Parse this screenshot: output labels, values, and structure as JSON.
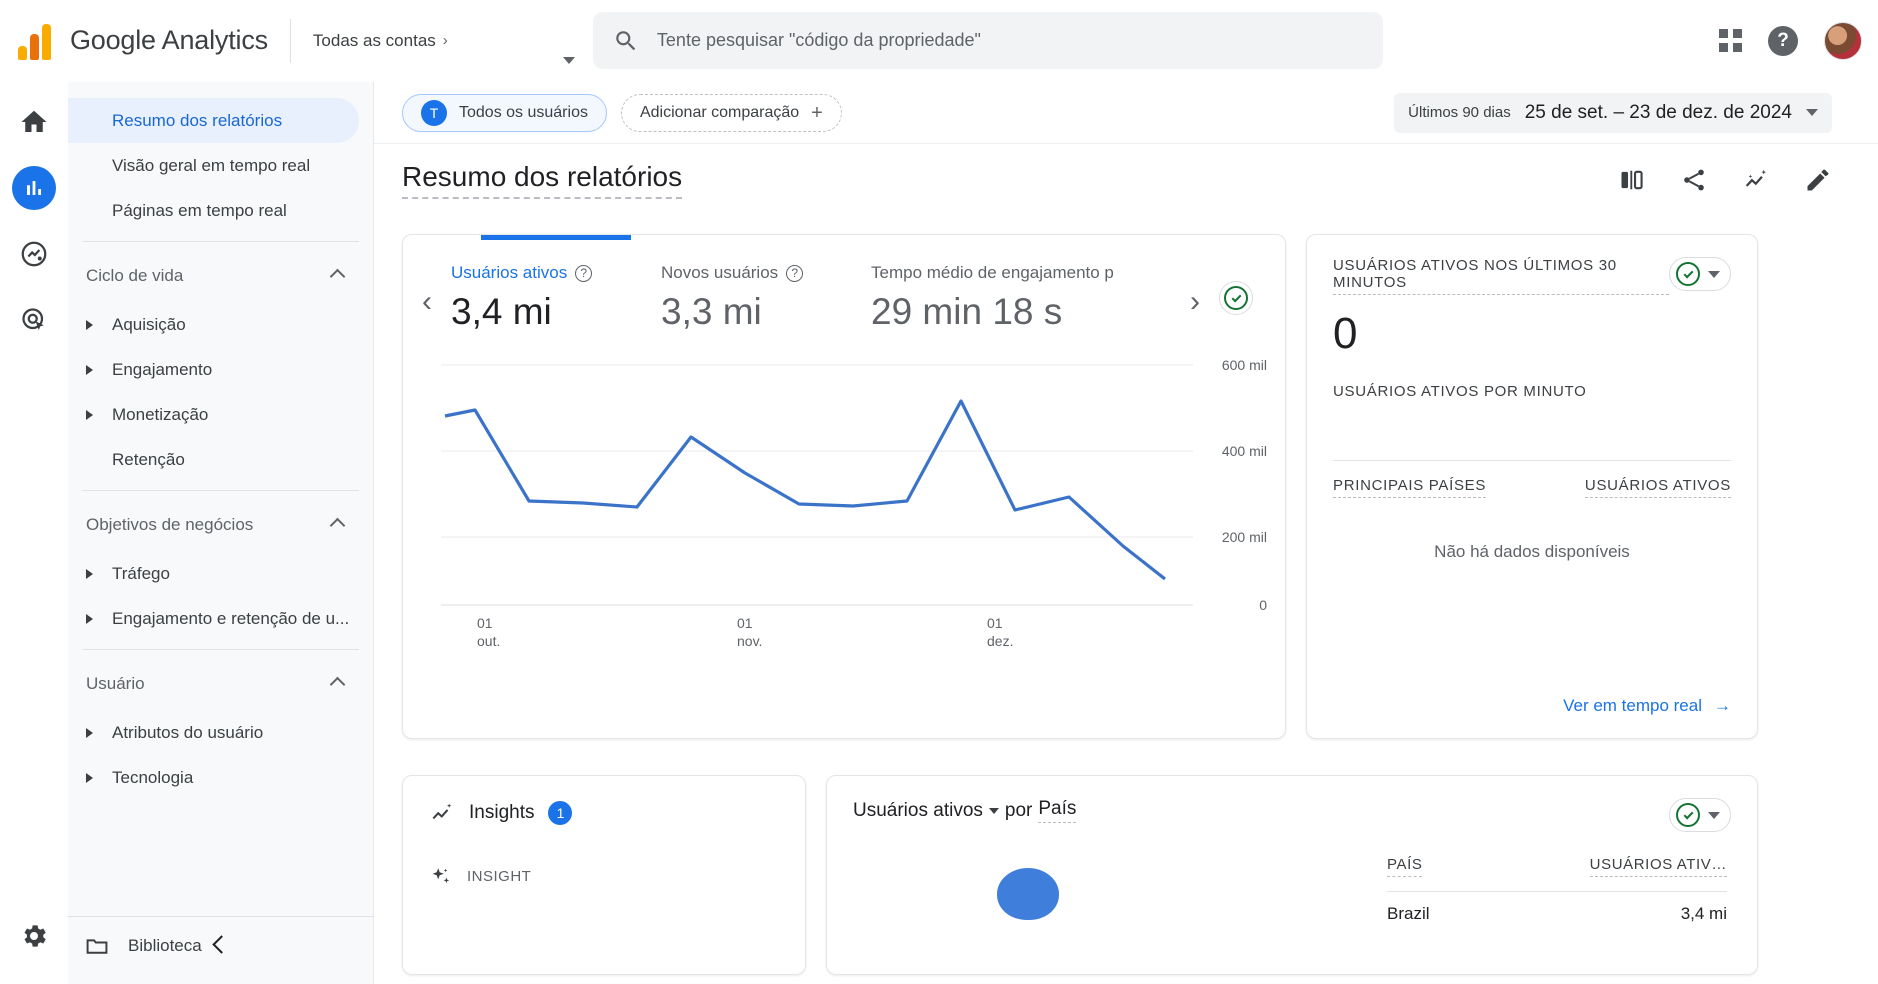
{
  "header": {
    "brand": "Google Analytics",
    "account_label": "Todas as contas",
    "account_chevron": "›",
    "search_placeholder": "Tente pesquisar \"código da propriedade\"",
    "apps_icon": "apps-grid-icon",
    "help_icon": "help-icon",
    "help_glyph": "?",
    "avatar_icon": "user-avatar"
  },
  "rail": {
    "items": [
      {
        "name": "home-icon",
        "label": "Início"
      },
      {
        "name": "reports-icon",
        "label": "Relatórios"
      },
      {
        "name": "explore-icon",
        "label": "Explorar"
      },
      {
        "name": "advertising-icon",
        "label": "Publicidade"
      }
    ],
    "settings": {
      "name": "gear-icon",
      "label": "Administrador"
    }
  },
  "sidebar": {
    "top_items": [
      {
        "label": "Resumo dos relatórios",
        "selected": true
      },
      {
        "label": "Visão geral em tempo real",
        "selected": false
      },
      {
        "label": "Páginas em tempo real",
        "selected": false
      }
    ],
    "groups": [
      {
        "title": "Ciclo de vida",
        "items": [
          {
            "label": "Aquisição",
            "expandable": true
          },
          {
            "label": "Engajamento",
            "expandable": true
          },
          {
            "label": "Monetização",
            "expandable": true
          },
          {
            "label": "Retenção",
            "expandable": false
          }
        ]
      },
      {
        "title": "Objetivos de negócios",
        "items": [
          {
            "label": "Tráfego",
            "expandable": true
          },
          {
            "label": "Engajamento e retenção de u...",
            "expandable": true
          }
        ]
      },
      {
        "title": "Usuário",
        "items": [
          {
            "label": "Atributos do usuário",
            "expandable": true
          },
          {
            "label": "Tecnologia",
            "expandable": true
          }
        ]
      }
    ],
    "library": {
      "label": "Biblioteca",
      "icon": "folder-icon"
    },
    "collapse": {
      "icon": "chevron-left-icon"
    }
  },
  "toolbar": {
    "all_users_chip": {
      "avatar": "T",
      "label": "Todos os usuários"
    },
    "add_comparison": {
      "label": "Adicionar comparação",
      "plus": "+"
    },
    "date_range": {
      "preset_label": "Últimos 90 dias",
      "value": "25 de set. – 23 de dez. de 2024"
    }
  },
  "page": {
    "title": "Resumo dos relatórios",
    "actions": [
      {
        "name": "compare-view-icon"
      },
      {
        "name": "share-icon"
      },
      {
        "name": "insights-icon"
      },
      {
        "name": "edit-pencil-icon"
      }
    ]
  },
  "overview_card": {
    "prev_arrow": "‹",
    "next_arrow": "›",
    "metrics": [
      {
        "label": "Usuários ativos",
        "value": "3,4 mi",
        "active": true
      },
      {
        "label": "Novos usuários",
        "value": "3,3 mi",
        "active": false
      },
      {
        "label": "Tempo médio de engajamento p",
        "value": "29 min 18 s",
        "active": false
      }
    ]
  },
  "chart_data": {
    "type": "line",
    "title": "Usuários ativos",
    "xlabel": "",
    "ylabel": "",
    "ylim": [
      0,
      600000
    ],
    "yticks": [
      0,
      200000,
      400000,
      600000
    ],
    "ytick_labels": [
      "0",
      "200 mil",
      "400 mil",
      "600 mil"
    ],
    "xtick_labels": [
      "01\nout.",
      "01\nnov.",
      "01\ndez."
    ],
    "xticks_major": [
      {
        "day": "01",
        "month": "out."
      },
      {
        "day": "01",
        "month": "nov."
      },
      {
        "day": "01",
        "month": "dez."
      }
    ],
    "grid": true,
    "series": [
      {
        "name": "Usuários ativos",
        "color": "#3a73c8",
        "x": [
          0,
          1,
          2,
          3,
          4,
          5,
          6,
          7,
          8,
          9,
          10,
          11,
          12,
          13,
          14
        ],
        "values": [
          440000,
          455000,
          243000,
          238000,
          228000,
          390000,
          305000,
          240000,
          235000,
          243000,
          475000,
          222000,
          250000,
          155000,
          95000
        ]
      }
    ]
  },
  "realtime_card": {
    "title": "USUÁRIOS ATIVOS NOS ÚLTIMOS 30 MINUTOS",
    "value": "0",
    "per_minute_label": "USUÁRIOS ATIVOS POR MINUTO",
    "table_headers": {
      "country": "PRINCIPAIS PAÍSES",
      "users": "USUÁRIOS ATIVOS"
    },
    "empty_text": "Não há dados disponíveis",
    "link": "Ver em tempo real",
    "link_arrow": "→",
    "badge_icon": "check-circle-icon",
    "caret_icon": "chevron-down-icon"
  },
  "insights_card": {
    "title": "Insights",
    "count": "1",
    "icon": "insights-icon",
    "section_label": "INSIGHT",
    "section_icon": "sparkle-icon"
  },
  "country_card": {
    "title_metric": "Usuários ativos",
    "title_mid": "por",
    "title_dimension": "País",
    "badge_icon": "check-circle-icon",
    "caret_icon": "chevron-down-icon",
    "table_headers": {
      "country": "PAÍS",
      "users": "USUÁRIOS ATIV…"
    },
    "rows": [
      {
        "country": "Brazil",
        "users": "3,4 mi"
      }
    ]
  }
}
